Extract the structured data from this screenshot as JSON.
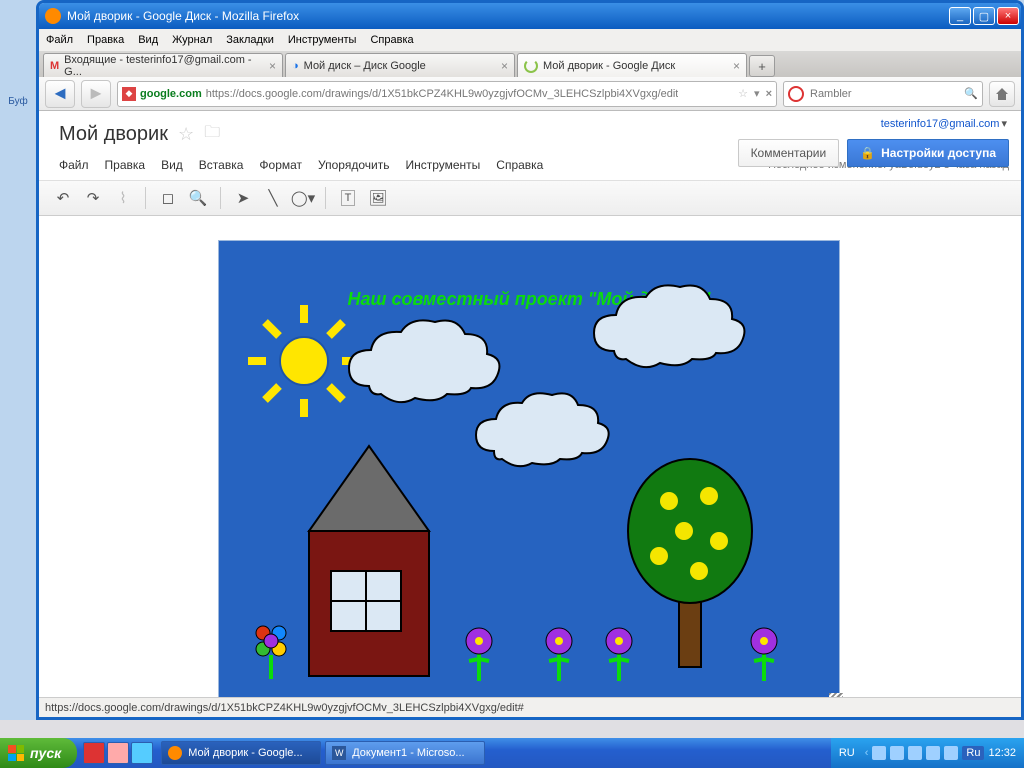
{
  "window": {
    "title": "Мой дворик - Google Диск - Mozilla Firefox"
  },
  "firefox_menu": [
    "Файл",
    "Правка",
    "Вид",
    "Журнал",
    "Закладки",
    "Инструменты",
    "Справка"
  ],
  "tabs": [
    {
      "label": "Входящие - testerinfo17@gmail.com - G...",
      "active": false
    },
    {
      "label": "Мой диск – Диск Google",
      "active": false
    },
    {
      "label": "Мой дворик - Google Диск",
      "active": true
    }
  ],
  "url": {
    "site": "google.com",
    "path": "https://docs.google.com/drawings/d/1X51bkCPZ4KHL9w0yzgjvfOCMv_3LEHCSzlpbi4XVgxg/edit"
  },
  "search_placeholder": "Rambler",
  "gdoc": {
    "account": "testerinfo17@gmail.com",
    "title": "Мой дворик",
    "btn_comments": "Комментарии",
    "btn_share": "Настройки доступа",
    "menu": [
      "Файл",
      "Правка",
      "Вид",
      "Вставка",
      "Формат",
      "Упорядочить",
      "Инструменты",
      "Справка"
    ],
    "last_change": "Последнее изменение: yaBoldey2 3 часа назад",
    "drawing_title": "Наш совместный проект \"Мой дворик\""
  },
  "statusbar": "https://docs.google.com/drawings/d/1X51bkCPZ4KHL9w0yzgjvfOCMv_3LEHCSzlpbi4XVgxg/edit#",
  "taskbar": {
    "start": "пуск",
    "items": [
      {
        "label": "Мой дворик - Google...",
        "active": true
      },
      {
        "label": "Документ1 - Microso...",
        "active": false
      }
    ],
    "lang_left": "RU",
    "lang": "Ru",
    "clock": "12:32"
  },
  "bg_sidebar_label": "Буф"
}
